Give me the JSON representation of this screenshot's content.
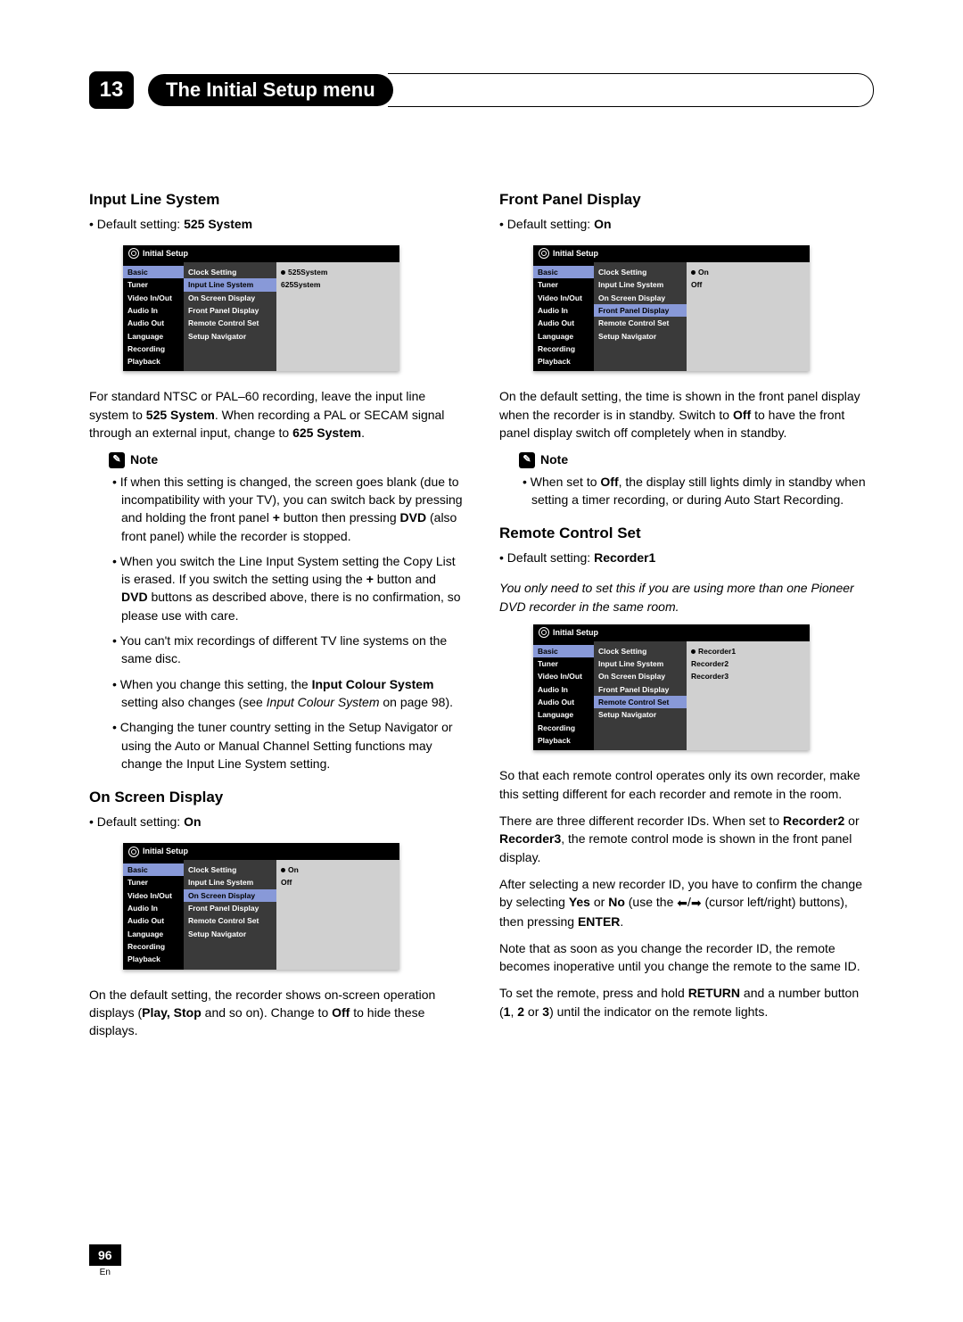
{
  "chapter_number": "13",
  "chapter_title": "The Initial Setup menu",
  "screenshot_title": "Initial Setup",
  "nav_items": [
    "Basic",
    "Tuner",
    "Video In/Out",
    "Audio In",
    "Audio Out",
    "Language",
    "Recording",
    "Playback"
  ],
  "setting_items": [
    "Clock Setting",
    "Input Line System",
    "On Screen Display",
    "Front Panel Display",
    "Remote Control Set",
    "Setup Navigator"
  ],
  "note_label": "Note",
  "sections": {
    "ils": {
      "title": "Input Line System",
      "default_label": "Default setting: ",
      "default_value": "525 System",
      "options": [
        "525System",
        "625System"
      ],
      "highlight": "Input Line System",
      "para": "For standard NTSC or PAL–60 recording, leave the input line system to 525 System. When recording a PAL or SECAM signal through an external input, change to 625 System.",
      "notes": [
        "If when this setting is changed, the screen goes blank (due to incompatibility with your TV), you can switch back by pressing and holding the front panel + button then pressing DVD (also front panel) while the recorder is stopped.",
        "When you switch the Line Input System setting the Copy List is erased. If you switch the setting using the + button and DVD buttons as described above, there is no confirmation, so please use with care.",
        "You can't mix recordings of different TV line systems on the same disc.",
        "When you change this setting, the Input Colour System setting also changes (see Input Colour System on page 98).",
        "Changing the tuner country setting in the Setup Navigator or using the Auto or Manual Channel Setting functions may change the Input Line System setting."
      ]
    },
    "osd": {
      "title": "On Screen Display",
      "default_label": "Default setting: ",
      "default_value": "On",
      "options": [
        "On",
        "Off"
      ],
      "highlight": "On Screen Display",
      "para": "On the default setting, the recorder shows on-screen operation displays (Play, Stop and so on). Change to Off to hide these displays."
    },
    "fpd": {
      "title": "Front Panel Display",
      "default_label": "Default setting: ",
      "default_value": "On",
      "options": [
        "On",
        "Off"
      ],
      "highlight": "Front Panel Display",
      "para": "On the default setting, the time is shown in the front panel display when the recorder is in standby. Switch to Off to have the front panel display switch off completely when in standby.",
      "notes": [
        "When set to Off, the display still lights dimly in standby when setting a timer recording, or during Auto Start Recording."
      ]
    },
    "rcs": {
      "title": "Remote Control Set",
      "default_label": "Default setting: ",
      "default_value": "Recorder1",
      "options": [
        "Recorder1",
        "Recorder2",
        "Recorder3"
      ],
      "highlight": "Remote Control Set",
      "intro": "You only need to set this if you are using more than one Pioneer DVD recorder in the same room.",
      "paras": [
        "So that each remote control operates only its own recorder, make this setting different for each recorder and remote in the room.",
        "There are three different recorder IDs. When set to Recorder2 or Recorder3, the remote control mode is shown in the front panel display.",
        "After selecting a new recorder ID, you have to confirm the change by selecting Yes or No (use the ←/→ (cursor left/right) buttons), then pressing ENTER.",
        "Note that as soon as you change the recorder ID, the remote becomes inoperative until you change the remote to the same ID.",
        "To set the remote, press and hold RETURN and a number button (1, 2 or 3) until the indicator on the remote lights."
      ]
    }
  },
  "page_number": "96",
  "page_lang": "En"
}
